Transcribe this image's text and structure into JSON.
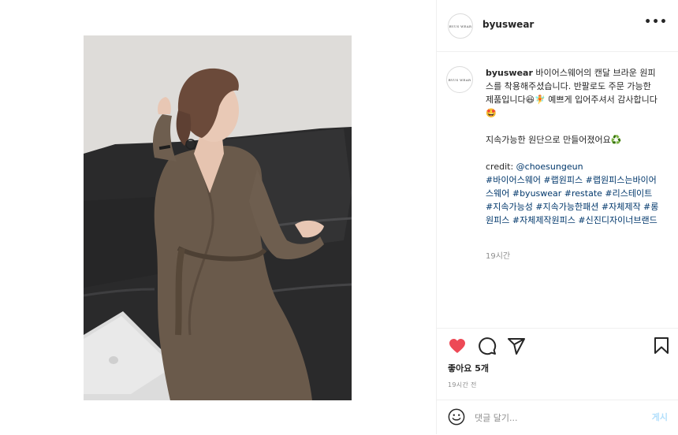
{
  "post": {
    "username": "byuswear",
    "avatar_text": "BYUS WEAR",
    "more_label": "•••",
    "caption": {
      "username": "byuswear",
      "line1_text": "바이어스웨어의 캔달 브라운 원피스를 착용해주셨습니다. 반팔로도 주문 가능한 제품입니다",
      "line1_emoji1": "😆",
      "line1_emoji2": "🧚",
      "line1_text2": "예쁘게 입어주셔서 감사합니다",
      "line1_emoji3": "🤩",
      "line2_text": "지속가능한 원단으로 만들어졌어요",
      "line2_emoji": "♻️",
      "credit_label": "credit:",
      "credit_user": "@choesungeun",
      "hashtags": "#바이어스웨어 #랩원피스 #랩원피스는바이어스웨어 #byuswear #restate #리스테이트 #지속가능성 #지속가능한패션 #자체제작 #롱원피스 #자체제작원피스 #신진디자이너브랜드"
    },
    "caption_time": "19시간",
    "likes": "좋아요 5개",
    "time_ago": "19시간 전",
    "comment_placeholder": "댓글 달기...",
    "post_button": "게시"
  },
  "icons": {
    "like": "heart-filled-icon",
    "comment": "comment-icon",
    "share": "send-icon",
    "save": "bookmark-icon",
    "emoji": "smiley-icon",
    "more": "more-icon"
  },
  "colors": {
    "like": "#ed4956",
    "link": "#00376b",
    "muted": "#8e8e8e",
    "post_disabled": "#b2dffc"
  }
}
